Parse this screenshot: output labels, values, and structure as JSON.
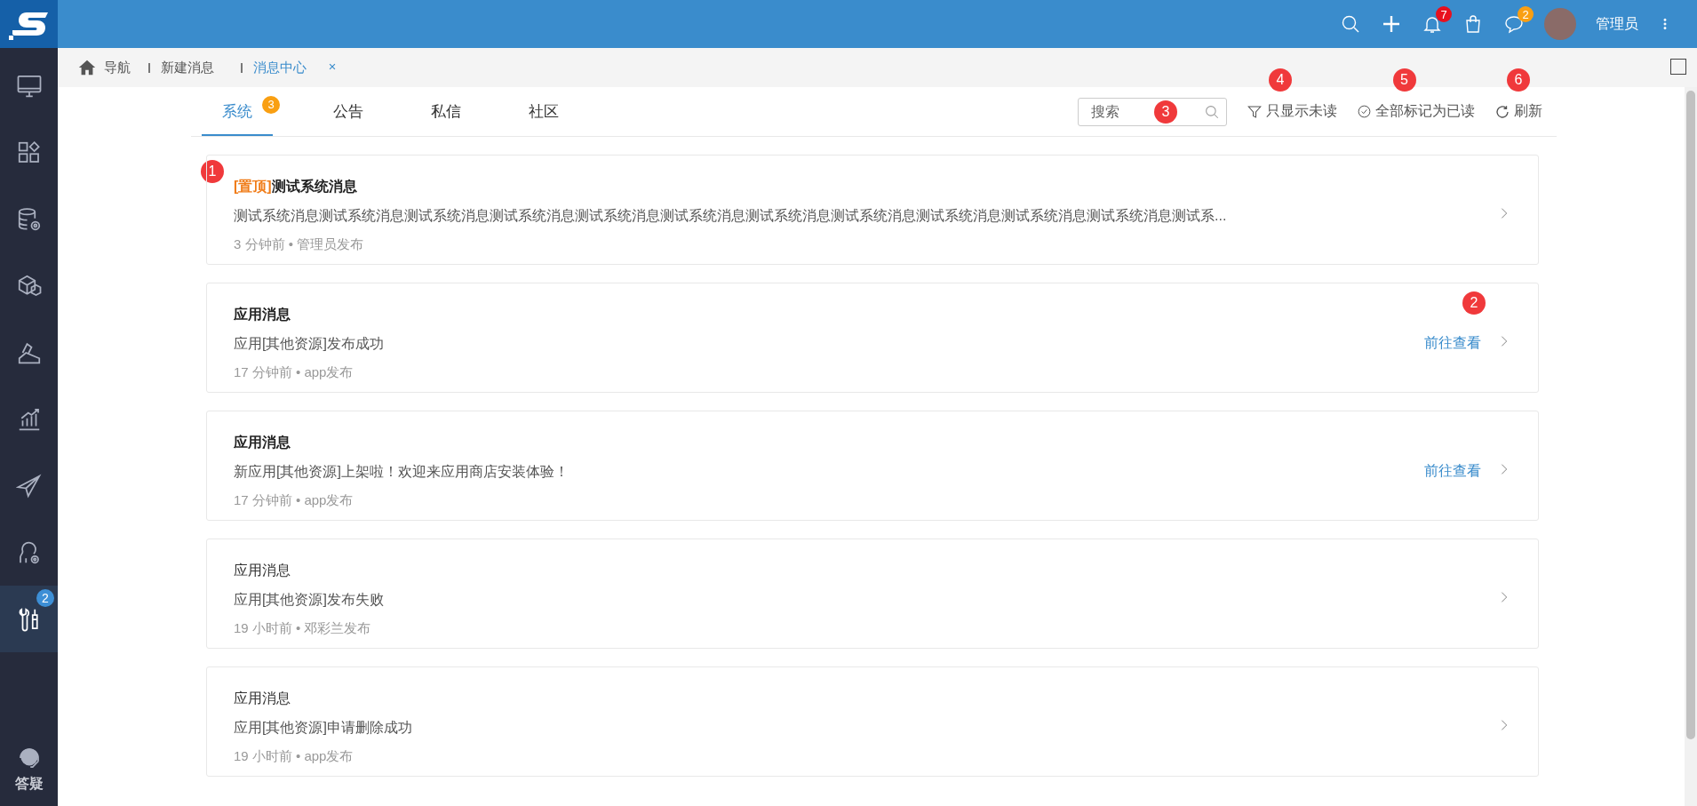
{
  "top_bar": {
    "notification_count": "7",
    "chat_count": "2",
    "user_name": "管理员"
  },
  "sidebar": {
    "items": [
      {
        "kind": "monitor",
        "selected": false
      },
      {
        "kind": "apps",
        "selected": false
      },
      {
        "kind": "database",
        "selected": false
      },
      {
        "kind": "cubes",
        "selected": false
      },
      {
        "kind": "ramp",
        "selected": false
      },
      {
        "kind": "chart",
        "selected": false
      },
      {
        "kind": "plane",
        "selected": false
      },
      {
        "kind": "person",
        "selected": false
      },
      {
        "kind": "tools",
        "selected": true,
        "badge": "2"
      }
    ],
    "help_label": "答疑"
  },
  "breadcrumbs": [
    {
      "kind": "home",
      "label": "导航",
      "selected": false
    },
    {
      "kind": "page",
      "label": "新建消息",
      "selected": false
    },
    {
      "kind": "page",
      "label": "消息中心",
      "selected": true
    }
  ],
  "tabs": [
    {
      "label": "系统",
      "selected": true,
      "badge": "3"
    },
    {
      "label": "公告",
      "selected": false
    },
    {
      "label": "私信",
      "selected": false
    },
    {
      "label": "社区",
      "selected": false
    }
  ],
  "toolbar": {
    "search": {
      "placeholder": "搜索",
      "callout": "3"
    },
    "filter": {
      "label": "只显示未读",
      "callout": "4"
    },
    "mark_all": {
      "label": "全部标记为已读",
      "callout": "5"
    },
    "refresh": {
      "label": "刷新",
      "callout": "6"
    }
  },
  "messages": [
    {
      "tag": "[置顶]",
      "title": "测试系统消息",
      "unread": true,
      "body": "测试系统消息测试系统消息测试系统消息测试系统消息测试系统消息测试系统消息测试系统消息测试系统消息测试系统消息测试系统消息测试系统消息测试系...",
      "meta": "3 分钟前 • 管理员发布",
      "callout": "1"
    },
    {
      "title": "应用消息",
      "unread": true,
      "body": "应用[其他资源]发布成功",
      "meta": "17 分钟前 • app发布",
      "link": "前往查看",
      "callout": "2"
    },
    {
      "title": "应用消息",
      "unread": true,
      "body": "新应用[其他资源]上架啦！欢迎来应用商店安装体验！",
      "meta": "17 分钟前 • app发布",
      "link": "前往查看"
    },
    {
      "title": "应用消息",
      "unread": false,
      "body": "应用[其他资源]发布失败",
      "meta": "19 小时前 • 邓彩兰发布"
    },
    {
      "title": "应用消息",
      "unread": false,
      "body": "应用[其他资源]申请删除成功",
      "meta": "19 小时前 • app发布"
    }
  ]
}
